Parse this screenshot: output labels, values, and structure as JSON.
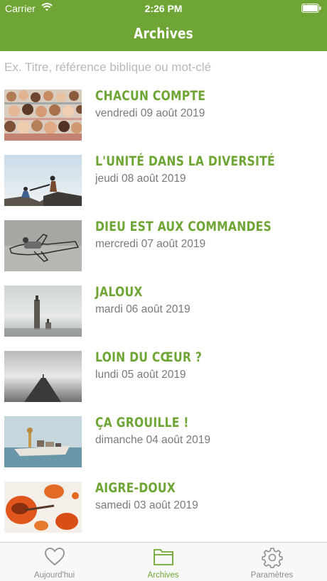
{
  "status_bar": {
    "carrier": "Carrier",
    "time": "2:26 PM"
  },
  "nav": {
    "title": "Archives"
  },
  "search": {
    "placeholder": "Ex. Titre, référence biblique ou mot-clé"
  },
  "items": [
    {
      "title": "CHACUN COMPTE",
      "date": "vendredi 09 août 2019",
      "image": "crowd-faces"
    },
    {
      "title": "L'UNITÉ DANS LA DIVERSITÉ",
      "date": "jeudi 08 août 2019",
      "image": "helping-hand-cliff"
    },
    {
      "title": "DIEU EST AUX COMMANDES",
      "date": "mercredi 07 août 2019",
      "image": "wire-airplane"
    },
    {
      "title": "JALOUX",
      "date": "mardi 06 août 2019",
      "image": "pillars-fog"
    },
    {
      "title": "LOIN DU CŒUR ?",
      "date": "lundi 05 août 2019",
      "image": "pier-mist"
    },
    {
      "title": "ÇA GROUILLE !",
      "date": "dimanche 04 août 2019",
      "image": "animals-boat"
    },
    {
      "title": "AIGRE-DOUX",
      "date": "samedi 03 août 2019",
      "image": "orange-sauce-spoon"
    }
  ],
  "tabs": [
    {
      "label": "Aujourd'hui",
      "icon": "heart-icon",
      "active": false
    },
    {
      "label": "Archives",
      "icon": "folder-icon",
      "active": true
    },
    {
      "label": "Paramètres",
      "icon": "gear-icon",
      "active": false
    }
  ],
  "colors": {
    "accent": "#6ea534",
    "date": "#7a7a7a",
    "tab_inactive": "#8e8e8e"
  }
}
